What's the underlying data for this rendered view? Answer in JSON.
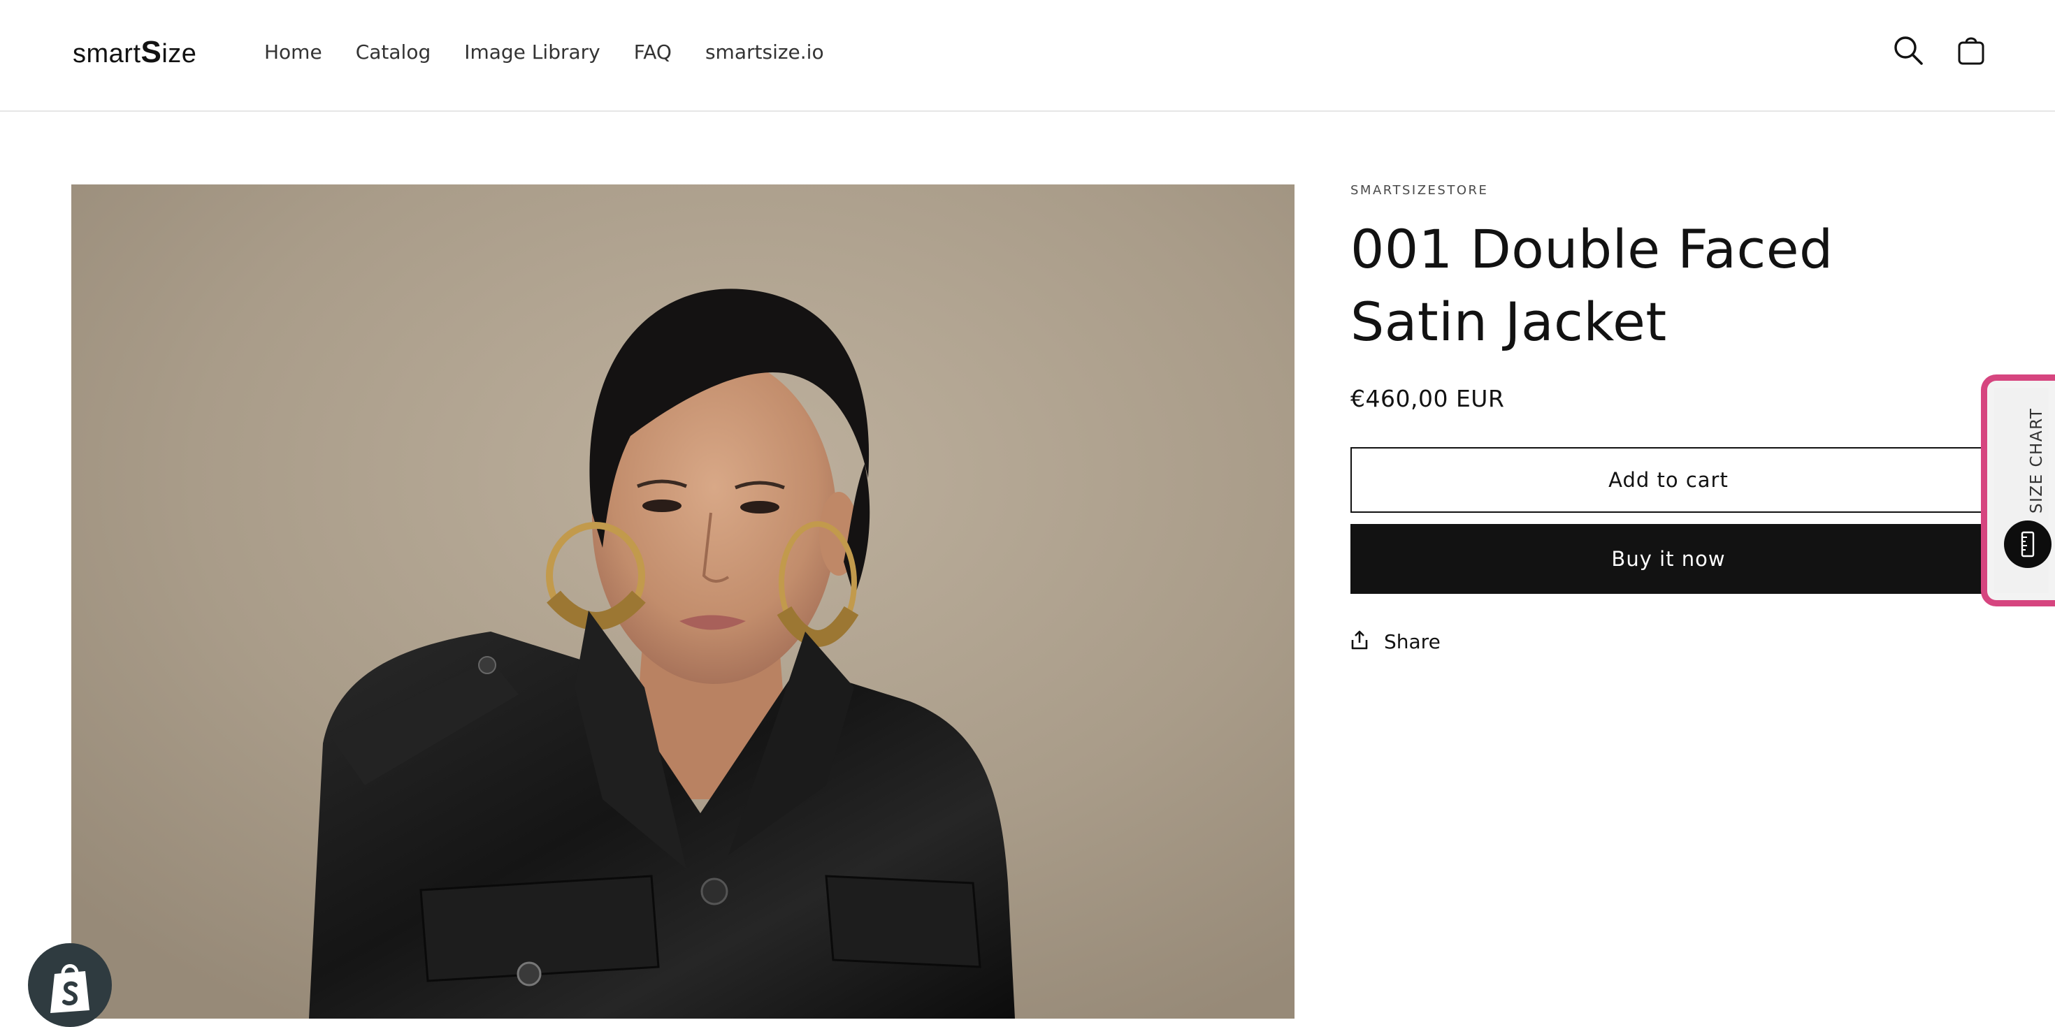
{
  "header": {
    "logo": {
      "prefix": "smart",
      "big_letter": "S",
      "suffix": "ize"
    },
    "nav": [
      {
        "label": "Home"
      },
      {
        "label": "Catalog"
      },
      {
        "label": "Image Library"
      },
      {
        "label": "FAQ"
      },
      {
        "label": "smartsize.io"
      }
    ],
    "icons": {
      "search": "search-icon",
      "cart": "cart-icon"
    }
  },
  "product": {
    "vendor": "SMARTSIZESTORE",
    "title": "001 Double Faced Satin Jacket",
    "price": "€460,00 EUR",
    "add_to_cart_label": "Add to cart",
    "buy_now_label": "Buy it now",
    "share_label": "Share",
    "image": "product-photo-model-black-satin-jacket"
  },
  "size_chart_widget": {
    "label": "SIZE CHART",
    "icon": "ruler-icon",
    "accent_color": "#d6457f"
  },
  "shopify_badge": {
    "icon": "shopify-bag-icon"
  },
  "colors": {
    "text": "#121212",
    "button_dark": "#121212",
    "accent": "#d6457f"
  }
}
